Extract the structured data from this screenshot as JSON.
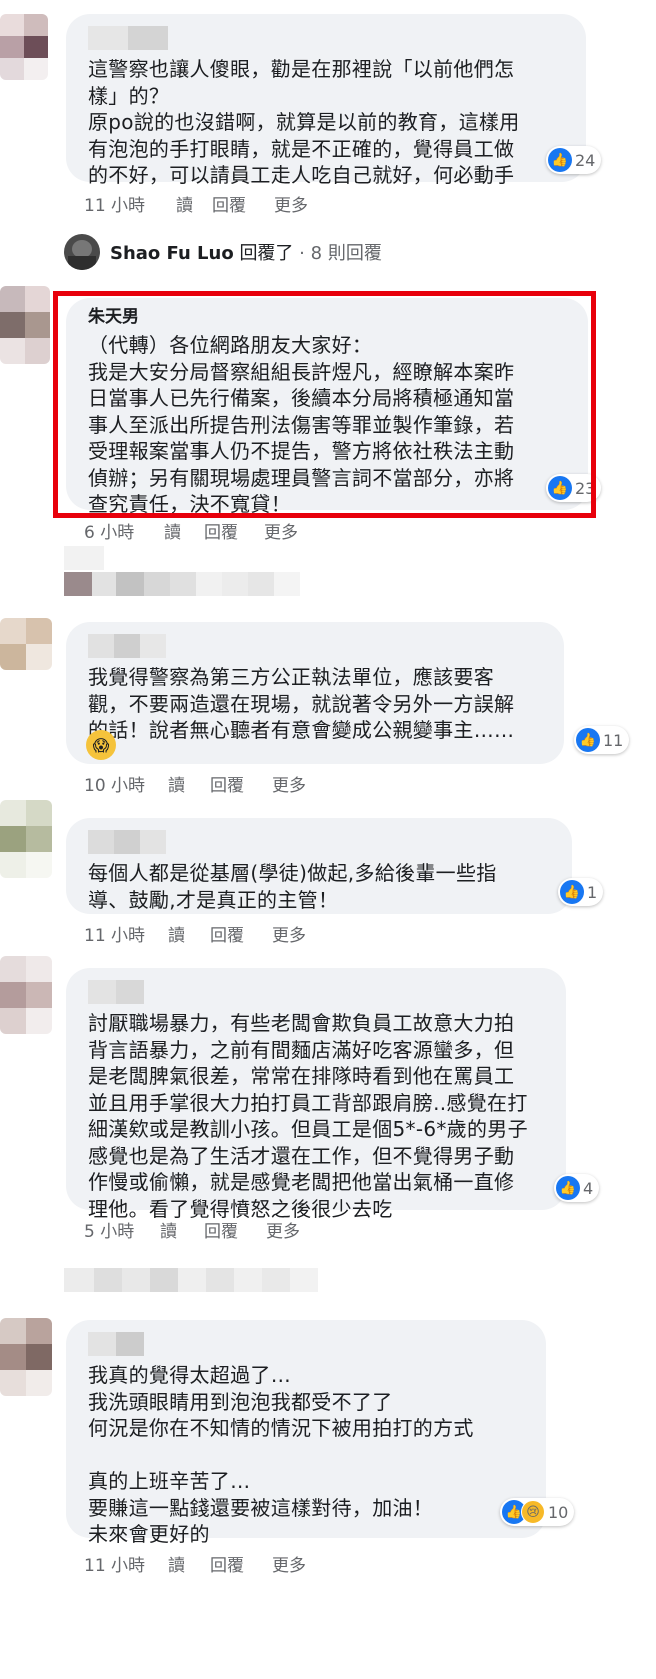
{
  "comments": [
    {
      "text": "這警察也讓人傻眼，勸是在那裡說「以前他們怎\n樣」的？\n原po說的也沒錯啊，就算是以前的教育，這樣用\n有泡泡的手打眼睛，就是不正確的，覺得員工做\n的不好，可以請員工走人吃自己就好，何必動手",
      "reactions": "24",
      "time": "11 小時"
    },
    {
      "author": "朱天男",
      "text": "（代轉）各位網路朋友大家好：\n我是大安分局督察組組長許煜凡，經瞭解本案昨\n日當事人已先行備案，後續本分局將積極通知當\n事人至派出所提告刑法傷害等罪並製作筆錄，若\n受理報案當事人仍不提告，警方將依社秩法主動\n偵辦；另有關現場處理員警言詞不當部分，亦將\n查究責任，決不寬貸！",
      "reactions": "23",
      "time": "6 小時"
    },
    {
      "text": "我覺得警察為第三方公正執法單位，應該要客\n觀，不要兩造還在現場，就說著令另外一方誤解\n的話！說者無心聽者有意會變成公親變事主……",
      "reactions": "11",
      "time": "10 小時"
    },
    {
      "text": "每個人都是從基層(學徒)做起,多給後輩一些指\n導、鼓勵,才是真正的主管！",
      "reactions": "1",
      "time": "11 小時"
    },
    {
      "text": "討厭職場暴力，有些老闆會欺負員工故意大力拍\n背言語暴力，之前有間麵店滿好吃客源蠻多，但\n是老闆脾氣很差，常常在排隊時看到他在罵員工\n並且用手掌很大力拍打員工背部跟肩膀..感覺在打\n細漢欸或是教訓小孩。但員工是個5*-6*歲的男子\n感覺也是為了生活才還在工作，但不覺得男子動\n作慢或偷懶，就是感覺老闆把他當出氣桶一直修\n理他。看了覺得憤怒之後很少去吃",
      "reactions": "4",
      "time": "5 小時"
    },
    {
      "text": "我真的覺得太超過了…\n我洗頭眼睛用到泡泡我都受不了了\n何況是你在不知情的情況下被用拍打的方式\n\n真的上班辛苦了…\n要賺這一點錢還要被這樣對待，加油！\n未來會更好的",
      "reactions": "10",
      "time": "11 小時"
    }
  ],
  "actions": {
    "read": "讀",
    "reply": "回覆",
    "more": "更多"
  },
  "reply_row": {
    "name": "Shao Fu Luo",
    "replied": "回覆了",
    "dot": "·",
    "count": "8 則回覆"
  },
  "icons": {
    "like": "like-icon",
    "sad": "sad-icon",
    "shocked_emoji": "shocked-face-icon"
  },
  "colors": {
    "bubble": "#f0f2f5",
    "like_blue": "#1877f2",
    "highlight_red": "#e8000b",
    "meta_gray": "#65676b"
  }
}
